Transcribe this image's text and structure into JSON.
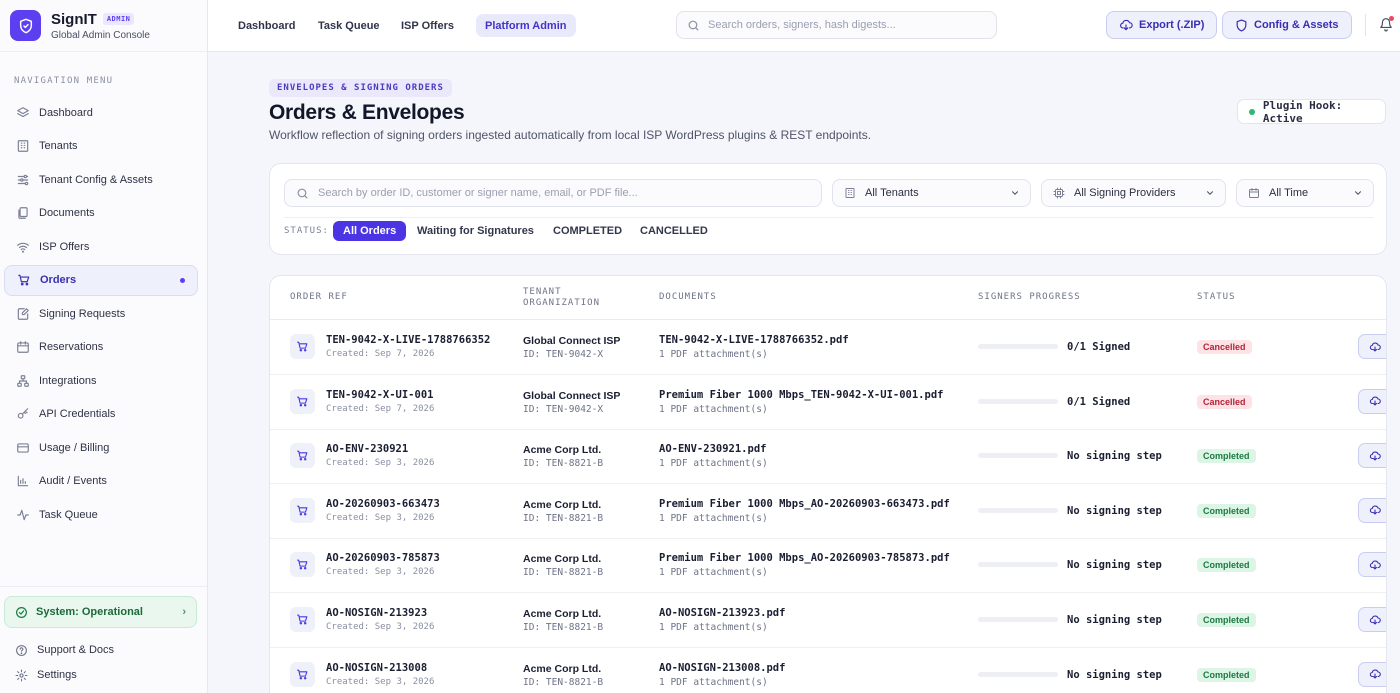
{
  "brand": {
    "name": "SignIT",
    "badge": "ADMIN",
    "subtitle": "Global Admin Console"
  },
  "sidebar": {
    "heading": "NAVIGATION MENU",
    "items": [
      {
        "label": "Dashboard",
        "icon": "layers-icon"
      },
      {
        "label": "Tenants",
        "icon": "building-icon"
      },
      {
        "label": "Tenant Config & Assets",
        "icon": "sliders-icon"
      },
      {
        "label": "Documents",
        "icon": "documents-icon"
      },
      {
        "label": "ISP Offers",
        "icon": "wifi-icon"
      },
      {
        "label": "Orders",
        "icon": "cart-icon",
        "active": true
      },
      {
        "label": "Signing Requests",
        "icon": "pen-document-icon"
      },
      {
        "label": "Reservations",
        "icon": "calendar-icon"
      },
      {
        "label": "Integrations",
        "icon": "network-icon"
      },
      {
        "label": "API Credentials",
        "icon": "key-icon"
      },
      {
        "label": "Usage / Billing",
        "icon": "credit-card-icon"
      },
      {
        "label": "Audit / Events",
        "icon": "bar-chart-icon"
      },
      {
        "label": "Task Queue",
        "icon": "activity-icon"
      }
    ],
    "system_status": "System: Operational",
    "footer": [
      {
        "label": "Support & Docs",
        "icon": "help-icon"
      },
      {
        "label": "Settings",
        "icon": "gear-icon"
      }
    ]
  },
  "topbar": {
    "tabs": [
      {
        "label": "Dashboard"
      },
      {
        "label": "Task Queue"
      },
      {
        "label": "ISP Offers"
      },
      {
        "label": "Platform Admin",
        "active": true
      }
    ],
    "search_placeholder": "Search orders, signers, hash digests...",
    "export_label": "Export (.ZIP)",
    "config_label": "Config & Assets"
  },
  "header": {
    "eyebrow": "ENVELOPES & SIGNING ORDERS",
    "title": "Orders & Envelopes",
    "subtitle": "Workflow reflection of signing orders ingested automatically from local ISP WordPress plugins & REST endpoints.",
    "plugin_status": "Plugin Hook: Active"
  },
  "filters": {
    "search_placeholder": "Search by order ID, customer or signer name, email, or PDF file...",
    "tenant": "All Tenants",
    "provider": "All Signing Providers",
    "time": "All Time",
    "status_label": "STATUS:",
    "statuses": [
      {
        "label": "All Orders",
        "active": true
      },
      {
        "label": "Waiting for Signatures"
      },
      {
        "label": "COMPLETED"
      },
      {
        "label": "CANCELLED"
      }
    ]
  },
  "table": {
    "headers": {
      "order_ref": "ORDER REF",
      "tenant_line1": "TENANT",
      "tenant_line2": "ORGANIZATION",
      "documents": "DOCUMENTS",
      "signers": "SIGNERS PROGRESS",
      "status": "STATUS"
    },
    "rows": [
      {
        "ref": "TEN-9042-X-LIVE-1788766352",
        "created": "Created: Sep 7, 2026",
        "tenant": "Global Connect ISP",
        "tenant_id": "ID: TEN-9042-X",
        "doc": "TEN-9042-X-LIVE-1788766352.pdf",
        "attachments": "1 PDF attachment(s)",
        "progress": 0,
        "signed": "0/1 Signed",
        "status": "Cancelled",
        "status_kind": "cancelled"
      },
      {
        "ref": "TEN-9042-X-UI-001",
        "created": "Created: Sep 7, 2026",
        "tenant": "Global Connect ISP",
        "tenant_id": "ID: TEN-9042-X",
        "doc": "Premium Fiber 1000 Mbps_TEN-9042-X-UI-001.pdf",
        "attachments": "1 PDF attachment(s)",
        "progress": 0,
        "signed": "0/1 Signed",
        "status": "Cancelled",
        "status_kind": "cancelled"
      },
      {
        "ref": "AO-ENV-230921",
        "created": "Created: Sep 3, 2026",
        "tenant": "Acme Corp Ltd.",
        "tenant_id": "ID: TEN-8821-B",
        "doc": "AO-ENV-230921.pdf",
        "attachments": "1 PDF attachment(s)",
        "progress": 0,
        "signed": "No signing step",
        "status": "Completed",
        "status_kind": "completed"
      },
      {
        "ref": "AO-20260903-663473",
        "created": "Created: Sep 3, 2026",
        "tenant": "Acme Corp Ltd.",
        "tenant_id": "ID: TEN-8821-B",
        "doc": "Premium Fiber 1000 Mbps_AO-20260903-663473.pdf",
        "attachments": "1 PDF attachment(s)",
        "progress": 0,
        "signed": "No signing step",
        "status": "Completed",
        "status_kind": "completed"
      },
      {
        "ref": "AO-20260903-785873",
        "created": "Created: Sep 3, 2026",
        "tenant": "Acme Corp Ltd.",
        "tenant_id": "ID: TEN-8821-B",
        "doc": "Premium Fiber 1000 Mbps_AO-20260903-785873.pdf",
        "attachments": "1 PDF attachment(s)",
        "progress": 0,
        "signed": "No signing step",
        "status": "Completed",
        "status_kind": "completed"
      },
      {
        "ref": "AO-NOSIGN-213923",
        "created": "Created: Sep 3, 2026",
        "tenant": "Acme Corp Ltd.",
        "tenant_id": "ID: TEN-8821-B",
        "doc": "AO-NOSIGN-213923.pdf",
        "attachments": "1 PDF attachment(s)",
        "progress": 0,
        "signed": "No signing step",
        "status": "Completed",
        "status_kind": "completed"
      },
      {
        "ref": "AO-NOSIGN-213008",
        "created": "Created: Sep 3, 2026",
        "tenant": "Acme Corp Ltd.",
        "tenant_id": "ID: TEN-8821-B",
        "doc": "AO-NOSIGN-213008.pdf",
        "attachments": "1 PDF attachment(s)",
        "progress": 0,
        "signed": "No signing step",
        "status": "Completed",
        "status_kind": "completed"
      }
    ]
  },
  "colors": {
    "accent": "#4b34e3",
    "success": "#2eb872",
    "danger": "#b4233a"
  }
}
